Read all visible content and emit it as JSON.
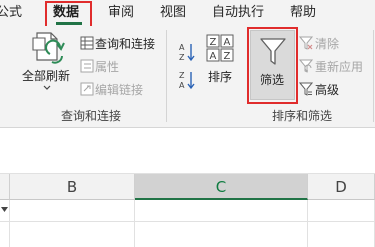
{
  "menubar": {
    "tabs": [
      {
        "label": "公式"
      },
      {
        "label": "数据"
      },
      {
        "label": "审阅"
      },
      {
        "label": "视图"
      },
      {
        "label": "自动执行"
      },
      {
        "label": "帮助"
      }
    ]
  },
  "ribbon": {
    "refresh_all": {
      "label": "全部刷新"
    },
    "queries_connections": {
      "label": "查询和连接"
    },
    "properties": {
      "label": "属性"
    },
    "edit_links": {
      "label": "编辑链接"
    },
    "group_queries": "查询和连接",
    "sort": {
      "label": "排序"
    },
    "filter": {
      "label": "筛选"
    },
    "clear": {
      "label": "清除"
    },
    "reapply": {
      "label": "重新应用"
    },
    "advanced": {
      "label": "高级"
    },
    "group_sort_filter": "排序和筛选"
  },
  "grid": {
    "columns": [
      "B",
      "C",
      "D"
    ],
    "selected_column": "C"
  },
  "colors": {
    "accent": "#217346",
    "highlight": "#e02c2c"
  }
}
